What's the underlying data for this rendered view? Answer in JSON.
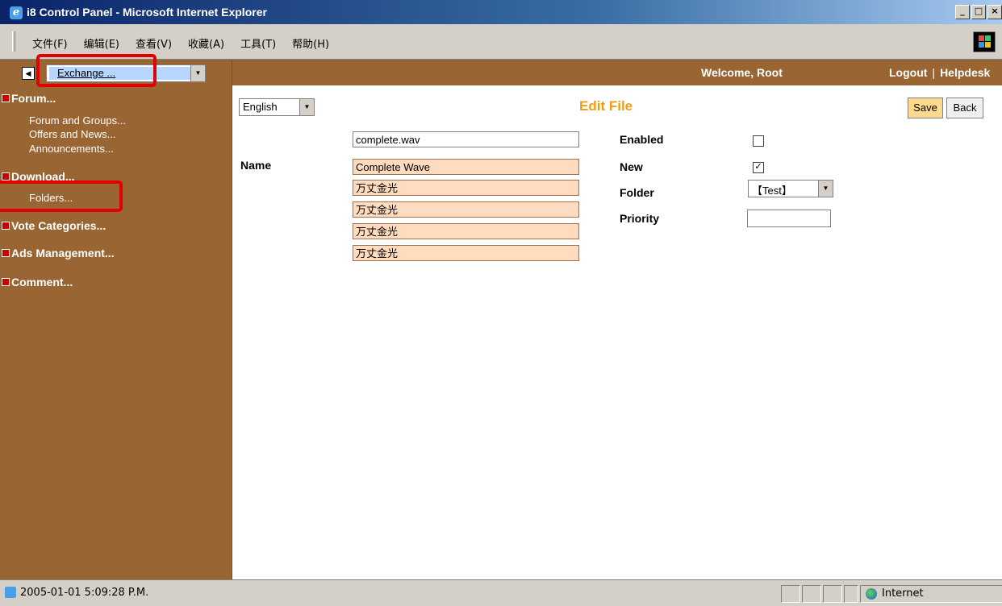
{
  "window": {
    "title": "i8 Control Panel - Microsoft Internet Explorer",
    "controls": [
      "_",
      "□",
      "×"
    ]
  },
  "menubar": {
    "items": [
      "文件(F)",
      "编辑(E)",
      "查看(V)",
      "收藏(A)",
      "工具(T)",
      "帮助(H)"
    ]
  },
  "header": {
    "collapse_glyph": "◀",
    "module_select": "Exchange ...",
    "welcome": "Welcome, Root",
    "logout": "Logout",
    "separator": "|",
    "helpdesk": "Helpdesk"
  },
  "sidebar": {
    "categories": [
      {
        "label": "Forum...",
        "items": [
          "Forum and Groups...",
          "Offers and News...",
          "Announcements..."
        ]
      },
      {
        "label": "Download...",
        "items": [
          "Folders..."
        ]
      },
      {
        "label": "Vote Categories...",
        "items": []
      },
      {
        "label": "Ads Management...",
        "items": []
      },
      {
        "label": "Comment...",
        "items": []
      }
    ]
  },
  "main": {
    "language": "English",
    "title": "Edit File",
    "save": "Save",
    "back": "Back",
    "filename": "complete.wav",
    "name_label": "Name",
    "names": [
      "Complete Wave",
      "万丈金光",
      "万丈金光",
      "万丈金光",
      "万丈金光"
    ],
    "enabled_label": "Enabled",
    "new_label": "New",
    "folder_label": "Folder",
    "priority_label": "Priority",
    "enabled": false,
    "new": true,
    "folder": "【Test】",
    "priority": ""
  },
  "statusbar": {
    "text": "2005-01-01 5:09:28 P.M.",
    "zone": "Internet"
  },
  "colors": {
    "sidebar_bg": "#996633",
    "title_accent": "#f39c12",
    "highlight_box": "#e00000",
    "field_peach": "#ffdcc0"
  }
}
